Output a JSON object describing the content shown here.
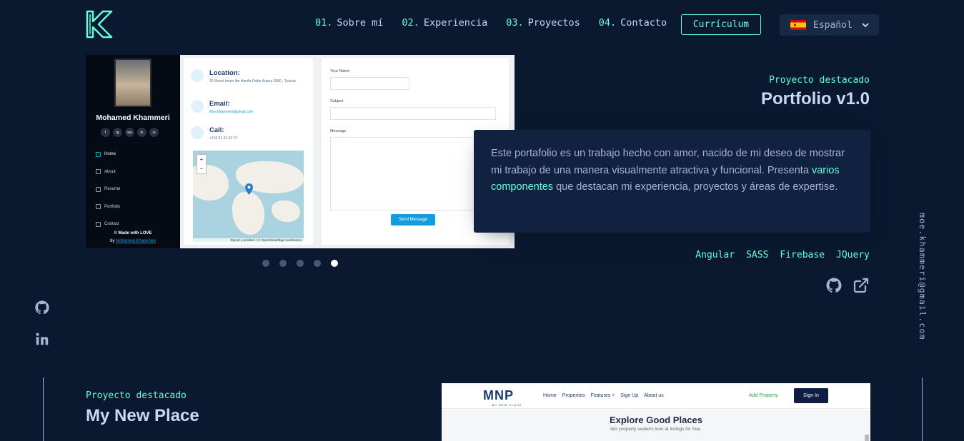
{
  "colors": {
    "background": "#0a192f",
    "accent": "#64ffda",
    "panel": "#112240",
    "text": "#ccd6f6",
    "muted": "#a8b2d1"
  },
  "header": {
    "logo_icon": "k-logo-icon",
    "nav": [
      {
        "num": "01.",
        "label": "Sobre mí"
      },
      {
        "num": "02.",
        "label": "Experiencia"
      },
      {
        "num": "03.",
        "label": "Proyectos"
      },
      {
        "num": "04.",
        "label": "Contacto"
      }
    ],
    "resume_button": "Currículum",
    "language": {
      "flag_icon": "spain-flag-icon",
      "label": "Español",
      "chevron_icon": "chevron-down-icon"
    }
  },
  "project1": {
    "overline": "Proyecto destacado",
    "title": "Portfolio v1.0",
    "description_before": "Este portafolio es un trabajo hecho con amor, nacido de mi deseo de mostrar mi trabajo de una manera visualmente atractiva y funcional. Presenta ",
    "description_highlight": "varios componentes",
    "description_after": " que destacan mi experiencia, proyectos y áreas de expertise.",
    "tech": [
      "Angular",
      "SASS",
      "Firebase",
      "JQuery"
    ],
    "links": {
      "github_icon": "github-icon",
      "external_icon": "external-link-icon"
    },
    "carousel": {
      "slides": 5,
      "active": 5
    },
    "screenshot": {
      "name": "Mohamed Khammeri",
      "socials": [
        "f",
        "ig",
        "wa",
        "in",
        "ui"
      ],
      "menu": [
        "Home",
        "About",
        "Resume",
        "Portfolio",
        "Contact"
      ],
      "footer_line1": "© Made with LOVE",
      "footer_by": "by",
      "footer_link": "Mohamed Khammeri",
      "location_label": "Location:",
      "location_value": "30 Street Imam Ibn Hanifa Petite Ariana 2080 , Tunisia",
      "email_label": "Email:",
      "email_value": "Moe.khammeri@gmail.com",
      "call_label": "Call:",
      "call_value": "+216 53 91 63 72",
      "map_zoom_in": "+",
      "map_zoom_out": "−",
      "map_credit": "Report a problem | © OpenStreetMap contributors",
      "form_name": "Your Name",
      "form_subject": "Subject",
      "form_message": "Message",
      "form_send": "Send Message"
    }
  },
  "side": {
    "left_icons": [
      "github-icon",
      "linkedin-icon"
    ],
    "email": "moe.khammeri@gmail.com"
  },
  "project2": {
    "overline": "Proyecto destacado",
    "title": "My New Place",
    "screenshot": {
      "logo": "MNP",
      "logo_sub": "MY NEW PLACE",
      "nav": [
        "Home",
        "Properties",
        "Features ˅",
        "Sign Up",
        "About us"
      ],
      "add_property": "Add Property",
      "sign_in": "Sign In",
      "hero_title": "Explore Good Places",
      "hero_subtitle": "lets property seekers look at listings for free."
    }
  }
}
